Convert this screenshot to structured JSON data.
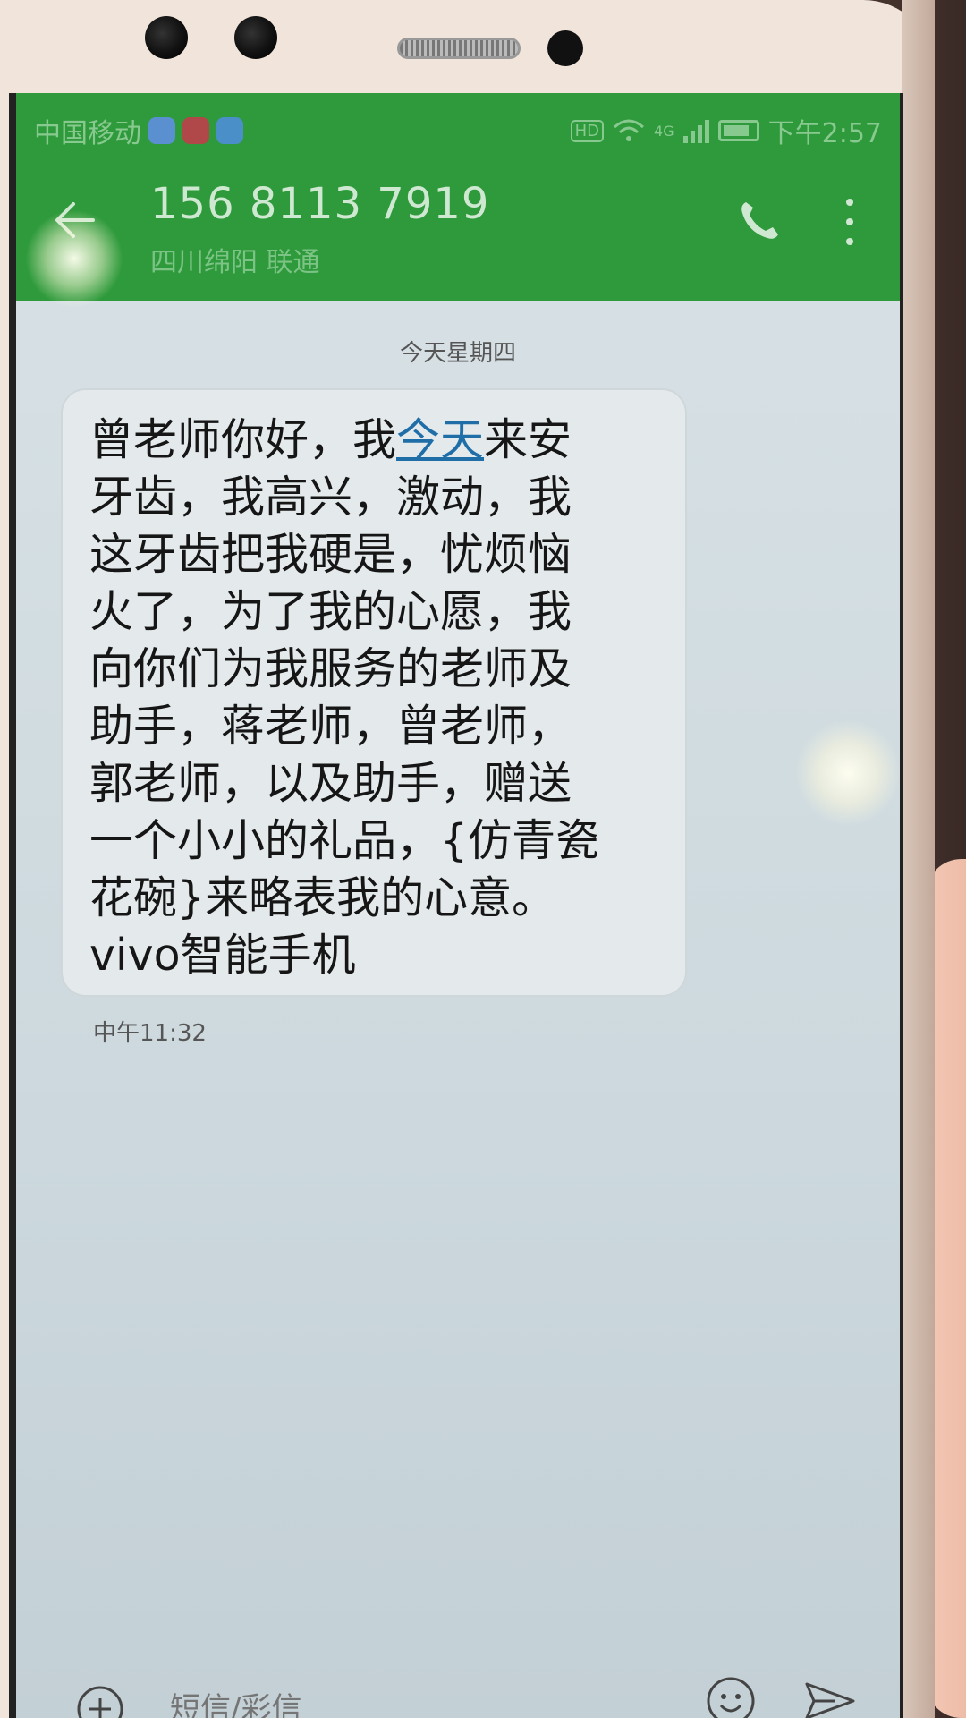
{
  "status_bar": {
    "carrier": "中国移动",
    "network": "4G",
    "hd": "HD",
    "time": "下午2:57"
  },
  "contact": {
    "number": "156 8113 7919",
    "location": "四川绵阳 联通"
  },
  "conversation": {
    "date_label": "今天星期四",
    "messages": [
      {
        "text_before_link": "曾老师你好，我",
        "link_text": "今天",
        "text_after_link": "来安\n牙齿，我高兴，激动，我\n这牙齿把我硬是，忧烦恼\n火了，为了我的心愿，我\n向你们为我服务的老师及\n助手，蒋老师，曾老师，\n郭老师，以及助手，赠送\n一个小小的礼品，{仿青瓷\n花碗}来略表我的心意。\nvivo智能手机",
        "time": "中午11:32"
      }
    ]
  },
  "composer": {
    "placeholder": "短信/彩信"
  },
  "icons": {
    "back": "back-arrow-icon",
    "call": "phone-icon",
    "more": "more-vertical-icon",
    "add": "add-icon",
    "emoji": "emoji-icon",
    "send": "send-icon"
  },
  "colors": {
    "app_bar": "#2e9a3b",
    "link": "#1f6ea8"
  }
}
